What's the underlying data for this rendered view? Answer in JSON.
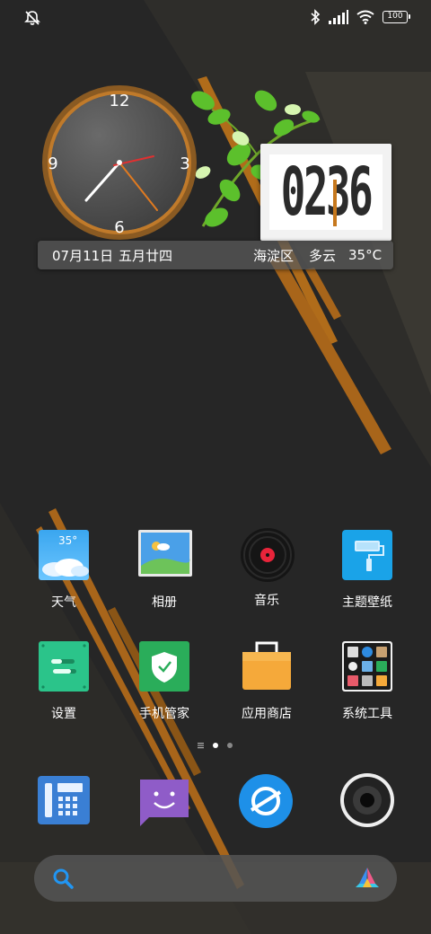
{
  "status_bar": {
    "left_icon": "silent-mode-icon",
    "right_icons": [
      "bluetooth-icon",
      "signal-icon",
      "wifi-icon",
      "battery-icon"
    ],
    "battery_level": "100"
  },
  "clock_widget": {
    "numbers": {
      "n12": "12",
      "n3": "3",
      "n6": "6",
      "n9": "9"
    },
    "time_shown": "02:36"
  },
  "digital_clock": {
    "hours": "02",
    "minutes": "36"
  },
  "info_bar": {
    "date": "07月11日",
    "lunar_date": "五月廿四",
    "district": "海淀区",
    "condition": "多云",
    "temperature": "35°C"
  },
  "apps": {
    "row1": [
      {
        "label": "天气",
        "icon": "weather-icon",
        "badge": "35°"
      },
      {
        "label": "相册",
        "icon": "gallery-icon"
      },
      {
        "label": "音乐",
        "icon": "music-icon"
      },
      {
        "label": "主题壁纸",
        "icon": "theme-icon"
      }
    ],
    "row2": [
      {
        "label": "设置",
        "icon": "settings-icon"
      },
      {
        "label": "手机管家",
        "icon": "security-icon"
      },
      {
        "label": "应用商店",
        "icon": "app-store-icon"
      },
      {
        "label": "系统工具",
        "icon": "system-tools-folder-icon"
      }
    ]
  },
  "page_indicator": {
    "pages": 2,
    "current": 1
  },
  "dock": [
    "phone-icon",
    "messages-icon",
    "browser-icon",
    "camera-icon"
  ],
  "search_bar": {
    "left_icon": "search-icon",
    "right_icon": "assistant-logo-icon"
  },
  "colors": {
    "accent": "#c6781d",
    "background": "#252525"
  }
}
